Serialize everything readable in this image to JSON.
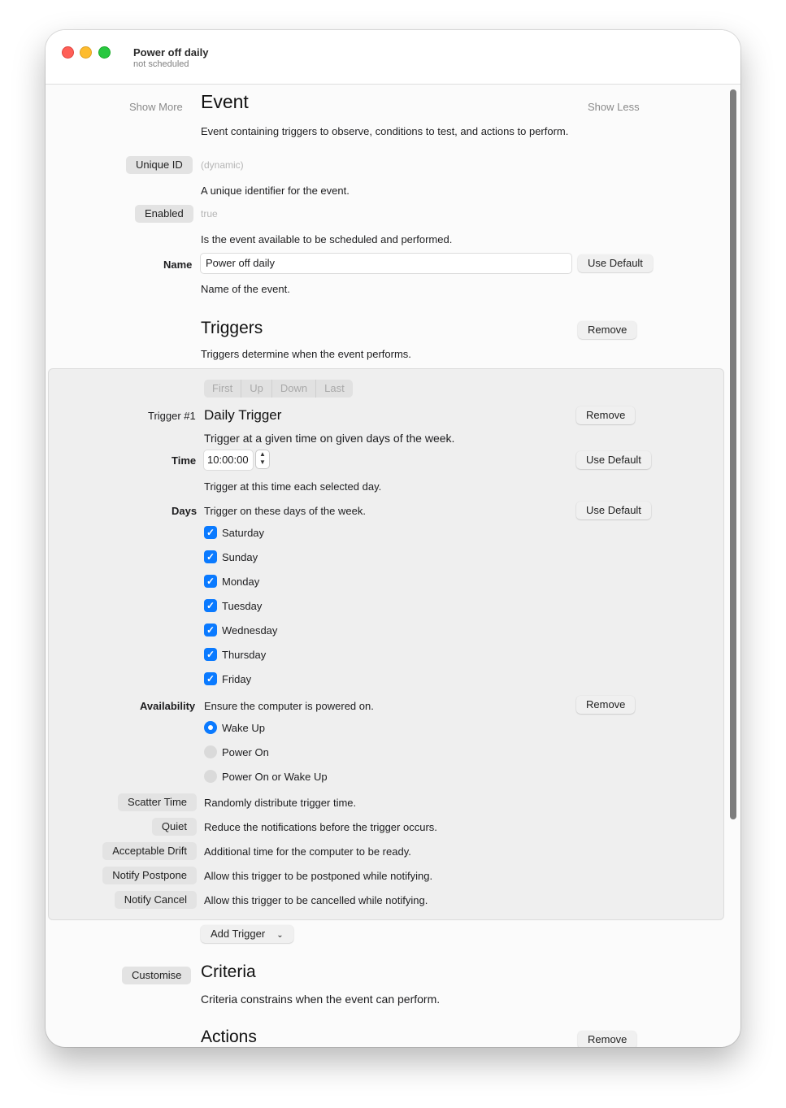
{
  "window": {
    "title": "Power off daily",
    "subtitle": "not scheduled"
  },
  "event": {
    "show_more": "Show More",
    "heading": "Event",
    "show_less": "Show Less",
    "description": "Event containing triggers to observe, conditions to test, and actions to perform.",
    "unique_id_button": "Unique ID",
    "unique_id_value": "(dynamic)",
    "unique_id_help": "A unique identifier for the event.",
    "enabled_button": "Enabled",
    "enabled_value": "true",
    "enabled_help": "Is the event available to be scheduled and performed.",
    "name_label": "Name",
    "name_value": "Power off daily",
    "name_default": "Use Default",
    "name_help": "Name of the event."
  },
  "triggers": {
    "heading": "Triggers",
    "remove": "Remove",
    "description": "Triggers determine when the event performs.",
    "order_buttons": [
      "First",
      "Up",
      "Down",
      "Last"
    ],
    "trigger_label": "Trigger #1",
    "trigger_title": "Daily Trigger",
    "trigger_remove": "Remove",
    "trigger_description": "Trigger at a given time on given days of the week.",
    "time_label": "Time",
    "time_value": "10:00:00",
    "time_default": "Use Default",
    "time_help": "Trigger at this time each selected day.",
    "days_label": "Days",
    "days_help": "Trigger on these days of the week.",
    "days_default": "Use Default",
    "days": [
      {
        "label": "Saturday",
        "checked": true
      },
      {
        "label": "Sunday",
        "checked": true
      },
      {
        "label": "Monday",
        "checked": true
      },
      {
        "label": "Tuesday",
        "checked": true
      },
      {
        "label": "Wednesday",
        "checked": true
      },
      {
        "label": "Thursday",
        "checked": true
      },
      {
        "label": "Friday",
        "checked": true
      }
    ],
    "availability_label": "Availability",
    "availability_help": "Ensure the computer is powered on.",
    "availability_remove": "Remove",
    "availability_options": [
      {
        "label": "Wake Up",
        "selected": true
      },
      {
        "label": "Power On",
        "selected": false
      },
      {
        "label": "Power On or Wake Up",
        "selected": false
      }
    ],
    "options": [
      {
        "button": "Scatter Time",
        "help": "Randomly distribute trigger time."
      },
      {
        "button": "Quiet",
        "help": "Reduce the notifications before the trigger occurs."
      },
      {
        "button": "Acceptable Drift",
        "help": "Additional time for the computer to be ready."
      },
      {
        "button": "Notify Postpone",
        "help": "Allow this trigger to be postponed while notifying."
      },
      {
        "button": "Notify Cancel",
        "help": "Allow this trigger to be cancelled while notifying."
      }
    ],
    "add_trigger": "Add Trigger"
  },
  "criteria": {
    "customise": "Customise",
    "heading": "Criteria",
    "description": "Criteria constrains when the event can perform."
  },
  "actions": {
    "heading": "Actions",
    "remove": "Remove"
  },
  "colors": {
    "accent": "#0a7aff",
    "close": "#ff5f57",
    "minimize": "#febc2e",
    "zoom": "#28c840"
  }
}
